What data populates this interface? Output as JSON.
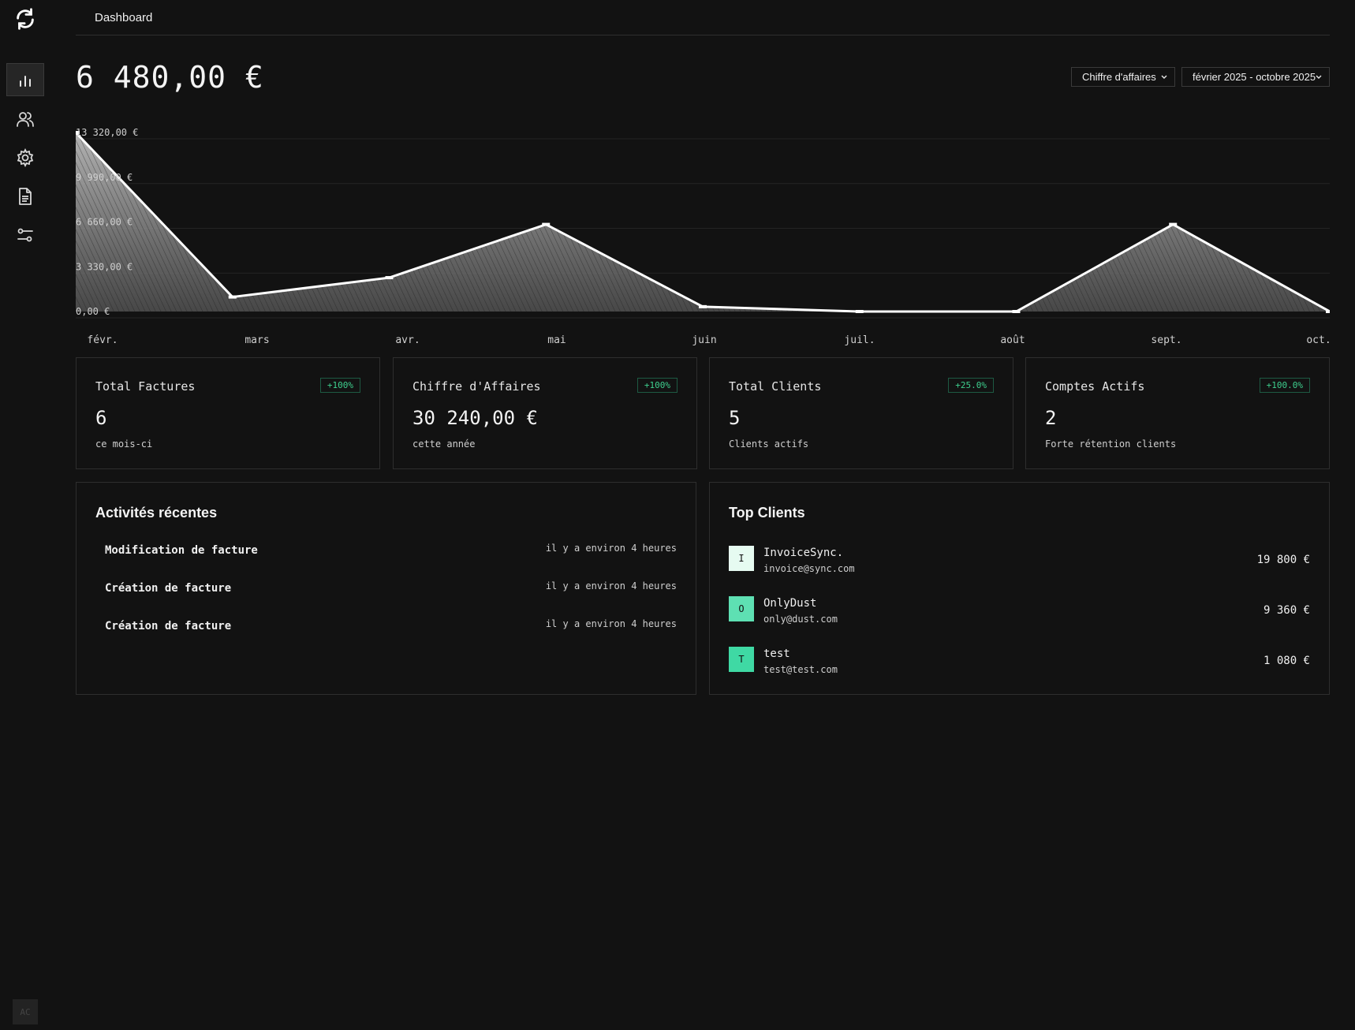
{
  "header": {
    "title": "Dashboard"
  },
  "sidebar": {
    "items": [
      {
        "name": "analytics",
        "icon": "bar-chart-icon",
        "active": true
      },
      {
        "name": "clients",
        "icon": "users-icon",
        "active": false
      },
      {
        "name": "settings",
        "icon": "gear-icon",
        "active": false
      },
      {
        "name": "documents",
        "icon": "document-icon",
        "active": false
      },
      {
        "name": "preferences",
        "icon": "sliders-icon",
        "active": false
      }
    ],
    "avatar_initials": "AC"
  },
  "summary": {
    "total": "6 480,00 €",
    "metric_select": "Chiffre d'affaires",
    "period_select": "février 2025 - octobre 2025"
  },
  "chart_data": {
    "type": "area",
    "categories": [
      "févr.",
      "mars",
      "avr.",
      "mai",
      "juin",
      "juil.",
      "août",
      "sept.",
      "oct."
    ],
    "values": [
      13320,
      1080,
      2520,
      6480,
      360,
      0,
      0,
      6480,
      0
    ],
    "y_tick_labels": [
      "13 320,00 €",
      "9 990,00 €",
      "6 660,00 €",
      "3 330,00 €",
      "0,00 €"
    ],
    "y_ticks": [
      13320,
      9990,
      6660,
      3330,
      0
    ],
    "ylim": [
      0,
      13320
    ],
    "grid": true,
    "colors": {
      "line": "#ffffff",
      "fill": "#8a8a8a"
    }
  },
  "stats": [
    {
      "label": "Total Factures",
      "badge": "+100%",
      "value": "6",
      "sub": "ce mois-ci"
    },
    {
      "label": "Chiffre d'Affaires",
      "badge": "+100%",
      "value": "30 240,00 €",
      "sub": "cette année"
    },
    {
      "label": "Total Clients",
      "badge": "+25.0%",
      "value": "5",
      "sub": "Clients actifs"
    },
    {
      "label": "Comptes Actifs",
      "badge": "+100.0%",
      "value": "2",
      "sub": "Forte rétention clients"
    }
  ],
  "activities": {
    "title": "Activités récentes",
    "items": [
      {
        "name": "Modification de facture",
        "time": "il y a environ 4 heures"
      },
      {
        "name": "Création de facture",
        "time": "il y a environ 4 heures"
      },
      {
        "name": "Création de facture",
        "time": "il y a environ 4 heures"
      }
    ]
  },
  "top_clients": {
    "title": "Top Clients",
    "items": [
      {
        "initial": "I",
        "name": "InvoiceSync.",
        "email": "invoice@sync.com",
        "amount": "19 800 €",
        "color": "#e6fbf1"
      },
      {
        "initial": "O",
        "name": "OnlyDust",
        "email": "only@dust.com",
        "amount": "9 360 €",
        "color": "#5ee0b3"
      },
      {
        "initial": "T",
        "name": "test",
        "email": "test@test.com",
        "amount": "1 080 €",
        "color": "#3fd9a4"
      }
    ]
  },
  "colors": {
    "accent": "#3ecf8e",
    "background": "#121212",
    "border": "#2e2e2e"
  }
}
